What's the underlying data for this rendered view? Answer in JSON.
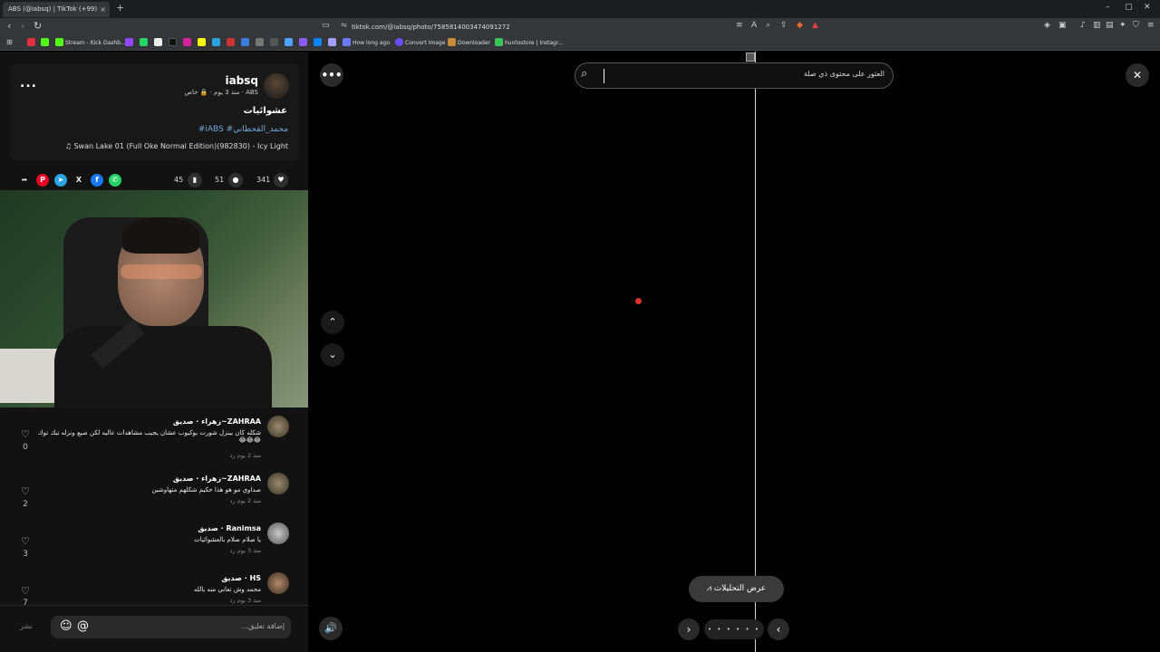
{
  "browser": {
    "tab_title": "ABS (@iabsq) | TikTok (+99)",
    "tab_close": "×",
    "new_tab": "+",
    "url": "tiktok.com/@iabsq/photo/7585814003474091272",
    "window_min": "–",
    "window_max": "▢",
    "window_close": "✕",
    "bookmarks": [
      {
        "label": "Stream - Kick Dashb...",
        "icon_color": "#53fc18"
      },
      {
        "label": "How long ago",
        "icon_color": "#6b7bff"
      },
      {
        "label": "Convert Image",
        "icon_color": "#6a4cff"
      },
      {
        "label": "Downloader",
        "icon_color": "#c78a3a"
      },
      {
        "label": "huntostore | Instagr...",
        "icon_color": "#3ac45a"
      }
    ]
  },
  "post": {
    "username": "iabsq",
    "meta": "ABS · منذ 3 يوم · 🔒 خاص",
    "more": "...",
    "caption": "عشوائيات",
    "hashtags": "#iABS #محمد_القحطاني",
    "music": "♫ Swan Lake 01 (Full Oke Normal Edition)(982830) - Icy Light",
    "likes": "341",
    "comments": "51",
    "saves": "45"
  },
  "comments": [
    {
      "name": "ZAHRAA~زهراء · صديق",
      "text": "شكله كان بينزل شورت بوكيوب عشان يجيب مشاهدات عاليه لكن صيع ونزله تيك توك 😂😂😂",
      "meta": "منذ 2 يوم    رد",
      "likes": "0"
    },
    {
      "name": "ZAHRAA~زهراء · صديق",
      "text": "صداوي مو هو هذا حكيم شكلهم متهاوشين",
      "meta": "منذ 2 يوم    رد",
      "likes": "2"
    },
    {
      "name": "Ranimsa · صديق",
      "text": "يا صلام صلام بالعشوائيات",
      "meta": "منذ 3 يوم    رد",
      "likes": "3"
    },
    {
      "name": "HS · صديق",
      "text": "محمد وش تعاني منه بالله",
      "meta": "منذ 3 يوم    رد",
      "likes": "7"
    }
  ],
  "composer": {
    "placeholder": "إضافة تعليق...",
    "post_label": "نشر"
  },
  "viewer": {
    "search_text": "العثور على محتوى ذي صلة",
    "analytics_label": "عرض التحليلات",
    "pager": "• • • • • •"
  },
  "colors": {
    "tiktok_link": "#6fa8dc",
    "pinterest": "#e60023",
    "telegram": "#2aa3e0",
    "facebook": "#1877f2",
    "whatsapp": "#25d366",
    "record_dot": "#e0302e"
  }
}
